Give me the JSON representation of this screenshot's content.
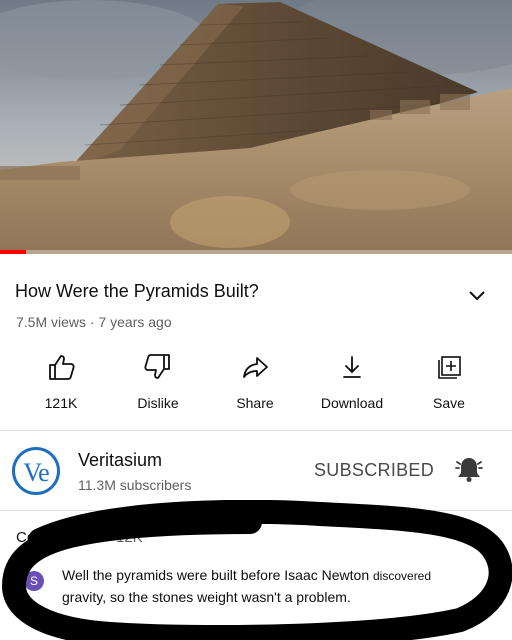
{
  "video": {
    "progress_fraction": 0.05,
    "colors": {
      "progress": "#ff0000"
    }
  },
  "title": "How Were the Pyramids Built?",
  "expand_icon": "chevron-down-icon",
  "meta": "7.5M views · 7 years ago",
  "actions": [
    {
      "label": "121K",
      "icon": "thumbs-up-icon"
    },
    {
      "label": "Dislike",
      "icon": "thumbs-down-icon"
    },
    {
      "label": "Share",
      "icon": "share-icon"
    },
    {
      "label": "Download",
      "icon": "download-icon"
    },
    {
      "label": "Save",
      "icon": "add-to-playlist-icon"
    }
  ],
  "channel": {
    "name": "Veritasium",
    "subscribers": "11.3M subscribers",
    "avatar_text": "Ve",
    "subscribe_state": "SUBSCRIBED",
    "bell_icon": "notification-bell-icon",
    "colors": {
      "avatar": "#1f6fc1"
    }
  },
  "comments": {
    "header": "Comments",
    "count": "12K",
    "top_comment": {
      "avatar_letter": "S",
      "text_main": "Well the pyramids were built before Isaac Newton ",
      "text_small": "discovered",
      "text_line2": "gravity, so the stones weight wasn't a problem."
    }
  }
}
